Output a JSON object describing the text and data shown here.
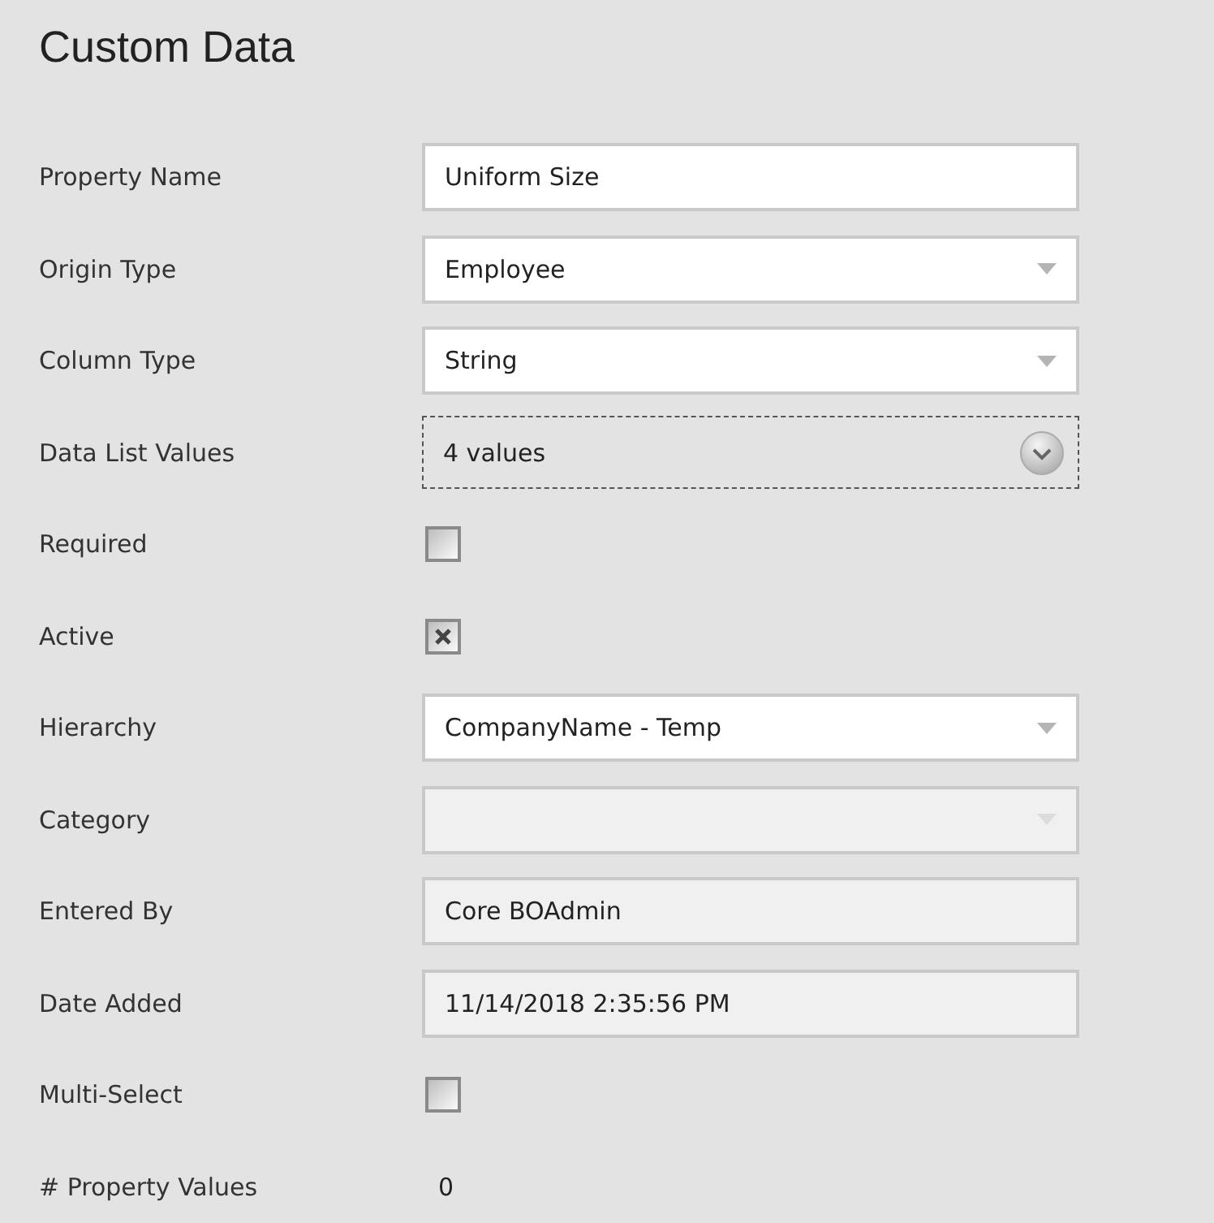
{
  "title": "Custom Data",
  "fields": [
    {
      "label": "Property Name",
      "kind": "text",
      "value": "Uniform Size"
    },
    {
      "label": "Origin Type",
      "kind": "select",
      "value": "Employee",
      "disabled": false
    },
    {
      "label": "Column Type",
      "kind": "select",
      "value": "String",
      "disabled": false
    },
    {
      "label": "Data List Values",
      "kind": "datalist",
      "value": "4 values"
    },
    {
      "label": "Required",
      "kind": "checkbox",
      "checked": false
    },
    {
      "label": "Active",
      "kind": "checkbox",
      "checked": true
    },
    {
      "label": "Hierarchy",
      "kind": "select",
      "value": "CompanyName - Temp",
      "disabled": false
    },
    {
      "label": "Category",
      "kind": "select",
      "disabled": true
    },
    {
      "label": "Entered By",
      "kind": "readonly",
      "value": "Core BOAdmin"
    },
    {
      "label": "Date Added",
      "kind": "readonly",
      "value": "11/14/2018 2:35:56 PM"
    },
    {
      "label": "Multi-Select",
      "kind": "checkbox",
      "checked": false
    },
    {
      "label": "# Property Values",
      "kind": "plain",
      "value": "0"
    }
  ]
}
